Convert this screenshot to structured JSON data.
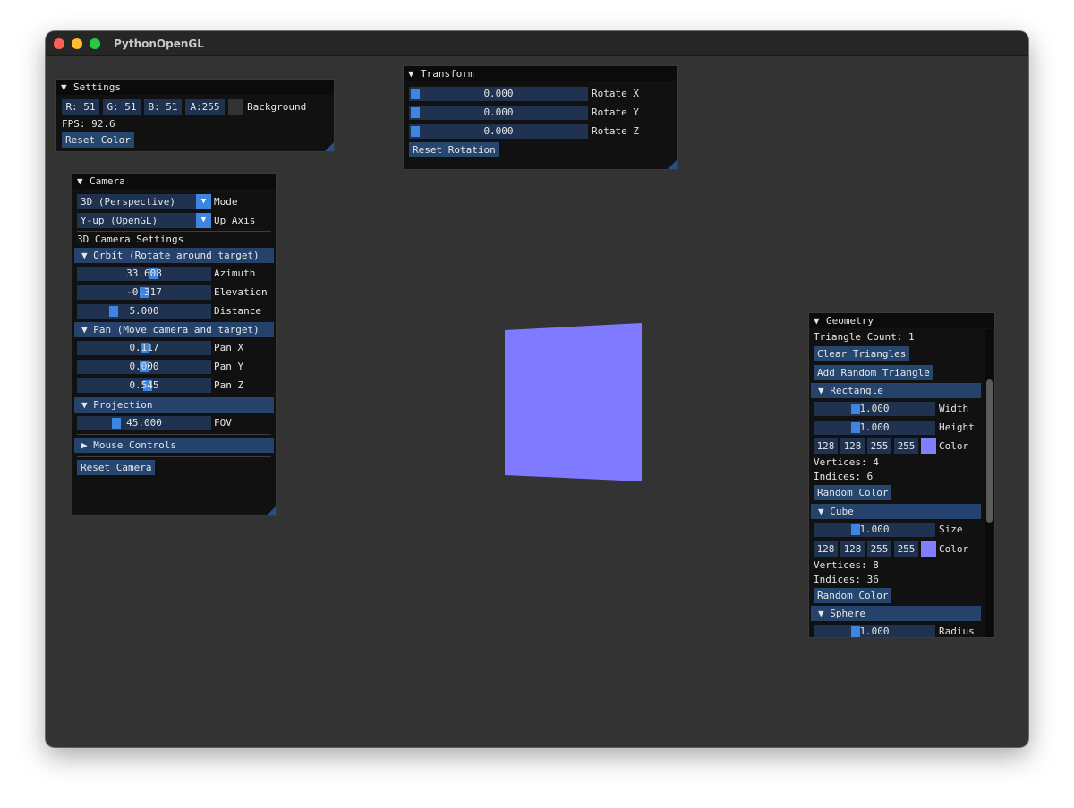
{
  "window": {
    "title": "PythonOpenGL"
  },
  "settings": {
    "title": "Settings",
    "r": "R: 51",
    "g": "G: 51",
    "b": "B: 51",
    "a": "A:255",
    "bg_swatch": "#333333",
    "background_label": "Background",
    "fps": "FPS: 92.6",
    "reset": "Reset Color"
  },
  "transform": {
    "title": "Transform",
    "rows": [
      {
        "value": "0.000",
        "label": "Rotate X",
        "level": 0.0
      },
      {
        "value": "0.000",
        "label": "Rotate Y",
        "level": 0.0
      },
      {
        "value": "0.000",
        "label": "Rotate Z",
        "level": 0.0
      }
    ],
    "reset": "Reset Rotation"
  },
  "camera": {
    "title": "Camera",
    "mode_value": "3D (Perspective)",
    "mode_label": "Mode",
    "up_value": "Y-up (OpenGL)",
    "up_label": "Up Axis",
    "settings_label": "3D Camera Settings",
    "orbit_header": "Orbit (Rotate around target)",
    "azimuth": {
      "value": "33.608",
      "label": "Azimuth",
      "level": 0.58
    },
    "elevation": {
      "value": "-0.317",
      "label": "Elevation",
      "level": 0.5
    },
    "distance": {
      "value": "5.000",
      "label": "Distance",
      "level": 0.25
    },
    "pan_header": "Pan (Move camera and target)",
    "pan_x": {
      "value": "0.117",
      "label": "Pan X",
      "level": 0.51
    },
    "pan_y": {
      "value": "0.000",
      "label": "Pan Y",
      "level": 0.5
    },
    "pan_z": {
      "value": "0.545",
      "label": "Pan Z",
      "level": 0.53
    },
    "projection_header": "Projection",
    "fov": {
      "value": "45.000",
      "label": "FOV",
      "level": 0.27
    },
    "mouse_header": "Mouse Controls",
    "reset": "Reset Camera"
  },
  "geometry": {
    "title": "Geometry",
    "triangle_count": "Triangle Count: 1",
    "clear": "Clear Triangles",
    "add": "Add Random Triangle",
    "rectangle": {
      "header": "Rectangle",
      "width": {
        "value": "1.000",
        "label": "Width",
        "level": 0.33
      },
      "height": {
        "value": "1.000",
        "label": "Height",
        "level": 0.33
      },
      "color": {
        "r": "128",
        "g": "128",
        "b": "255",
        "a": "255",
        "swatch": "#8080ff",
        "label": "Color"
      },
      "vertices": "Vertices: 4",
      "indices": "Indices: 6",
      "random": "Random Color"
    },
    "cube": {
      "header": "Cube",
      "size": {
        "value": "1.000",
        "label": "Size",
        "level": 0.33
      },
      "color": {
        "r": "128",
        "g": "128",
        "b": "255",
        "a": "255",
        "swatch": "#8080ff",
        "label": "Color"
      },
      "vertices": "Vertices: 8",
      "indices": "Indices: 36",
      "random": "Random Color"
    },
    "sphere": {
      "header": "Sphere",
      "radius": {
        "value": "1.000",
        "label": "Radius",
        "level": 0.33
      }
    },
    "scroll_position": 0.3
  },
  "scene": {
    "shape_color": "#7f7aff"
  }
}
